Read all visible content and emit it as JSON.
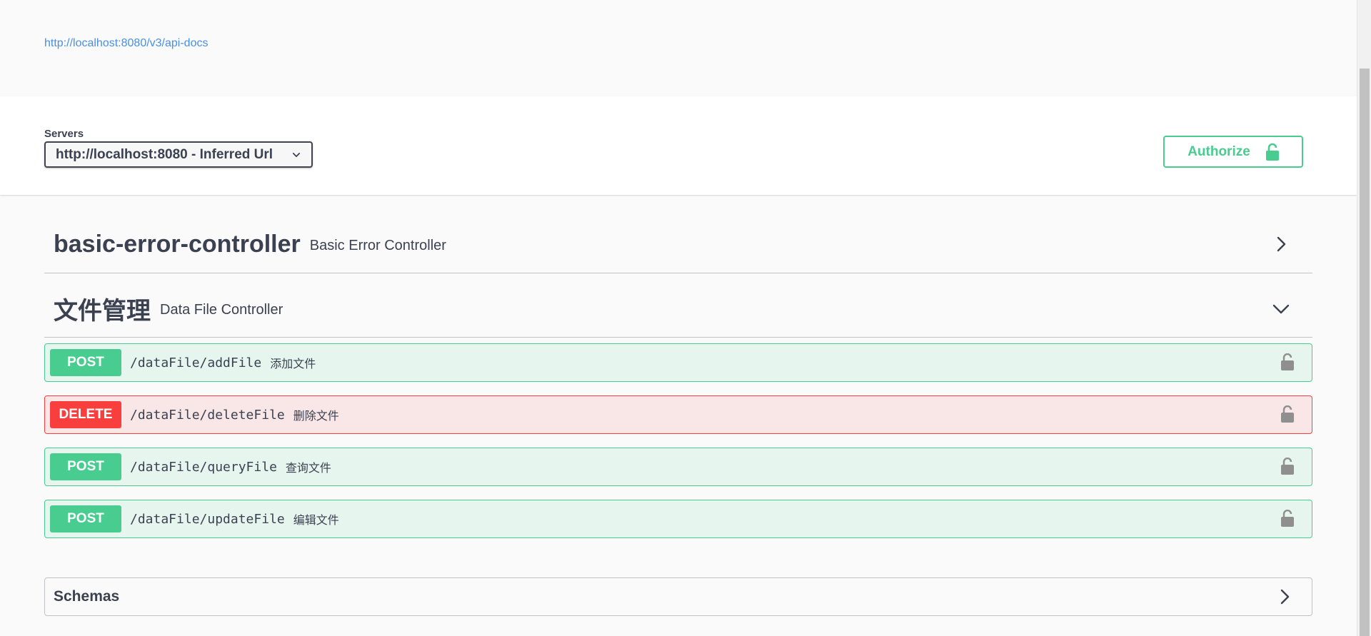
{
  "info": {
    "api_docs_link": "http://localhost:8080/v3/api-docs"
  },
  "servers": {
    "label": "Servers",
    "selected": "http://localhost:8080 - Inferred Url",
    "icon": "chevron-down-icon"
  },
  "authorize": {
    "label": "Authorize",
    "icon": "lock-open-icon",
    "color": "#49cc90"
  },
  "tags": [
    {
      "name": "basic-error-controller",
      "description": "Basic Error Controller",
      "expanded": false
    },
    {
      "name": "文件管理",
      "description": "Data File Controller",
      "expanded": true
    }
  ],
  "operations": [
    {
      "method": "POST",
      "path": "/dataFile/addFile",
      "summary": "添加文件",
      "color": "#49cc90"
    },
    {
      "method": "DELETE",
      "path": "/dataFile/deleteFile",
      "summary": "删除文件",
      "color": "#f93e3e"
    },
    {
      "method": "POST",
      "path": "/dataFile/queryFile",
      "summary": "查询文件",
      "color": "#49cc90"
    },
    {
      "method": "POST",
      "path": "/dataFile/updateFile",
      "summary": "编辑文件",
      "color": "#49cc90"
    }
  ],
  "schemas": {
    "label": "Schemas"
  }
}
